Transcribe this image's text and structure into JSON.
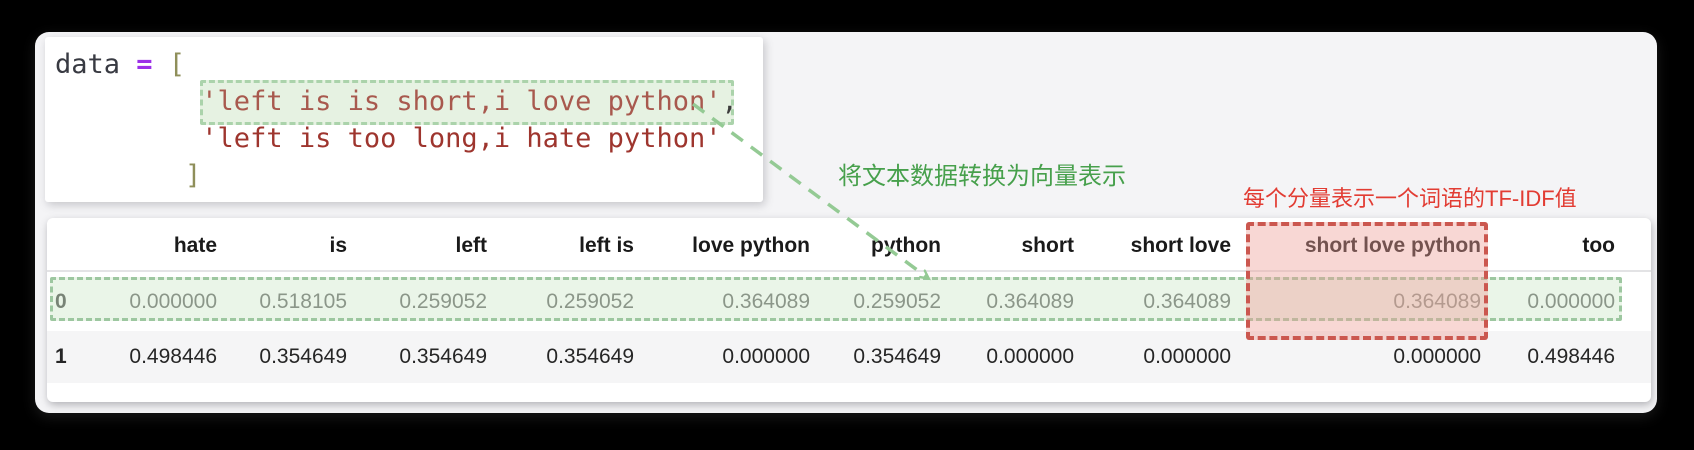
{
  "code": {
    "var_name": "data",
    "equals": "=",
    "open_bracket": "[",
    "string1": "'left is is short,i love python'",
    "comma": ",",
    "string2": "'left is too long,i hate python'",
    "close_bracket": "]"
  },
  "annotations": {
    "vectorize_note": "将文本数据转换为向量表示",
    "tfidf_note": "每个分量表示一个词语的TF-IDF值"
  },
  "table": {
    "index_header": "",
    "columns": [
      "hate",
      "is",
      "left",
      "left is",
      "love python",
      "python",
      "short",
      "short love",
      "short love python",
      "too"
    ],
    "rows": [
      {
        "index": "0",
        "values": [
          "0.000000",
          "0.518105",
          "0.259052",
          "0.259052",
          "0.364089",
          "0.259052",
          "0.364089",
          "0.364089",
          "0.364089",
          "0.000000"
        ]
      },
      {
        "index": "1",
        "values": [
          "0.498446",
          "0.354649",
          "0.354649",
          "0.354649",
          "0.000000",
          "0.354649",
          "0.000000",
          "0.000000",
          "0.000000",
          "0.498446"
        ]
      }
    ]
  },
  "colors": {
    "highlight_green_fill": "#e6f2e2",
    "highlight_green_border": "#9dc7a0",
    "overlay_red_border": "#cb574f",
    "annotation_green": "#47a04c",
    "annotation_red": "#e23c33",
    "string_red": "#9e352e",
    "operator_purple": "#9b30e8",
    "bracket_olive": "#8f8f5a",
    "arrow_green": "#94ca94"
  }
}
